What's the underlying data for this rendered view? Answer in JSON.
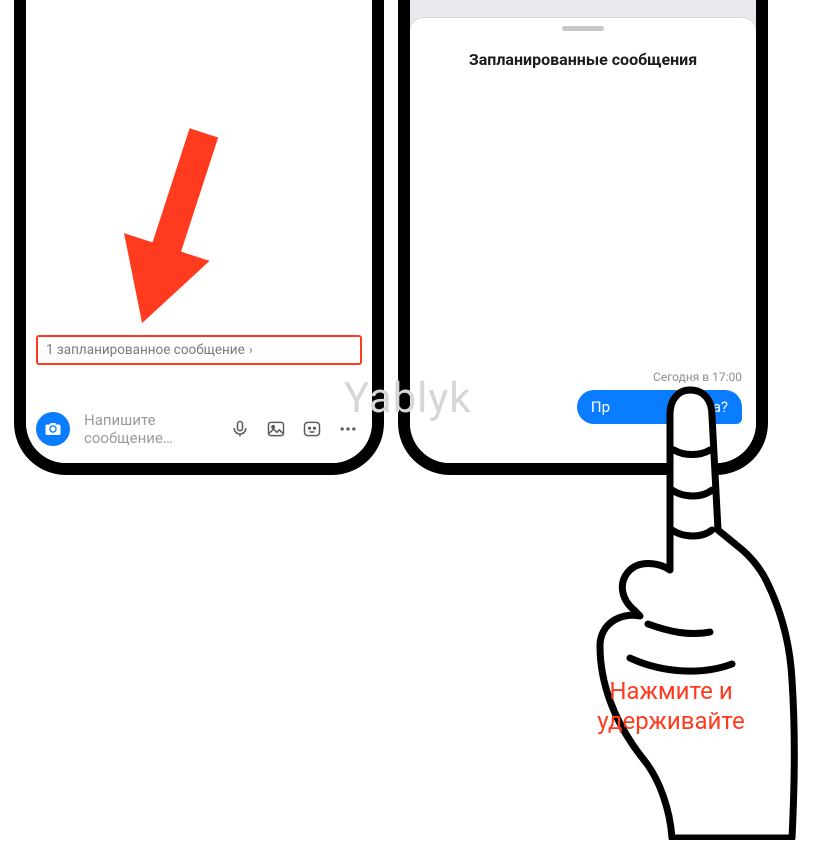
{
  "left": {
    "scheduled_banner": "1 запланированное сообщение",
    "compose_placeholder": "Напишите сообщение…"
  },
  "right": {
    "sheet_title": "Запланированные сообщения",
    "timestamp": "Сегодня в 17:00",
    "bubble_text_left": "Пр",
    "bubble_text_right": "к дела?"
  },
  "watermark": "Yablyk",
  "instruction_line1": "Нажмите и",
  "instruction_line2": "удерживайте",
  "colors": {
    "accent_blue": "#0a7cff",
    "annotation_red": "#ff3b1f"
  }
}
